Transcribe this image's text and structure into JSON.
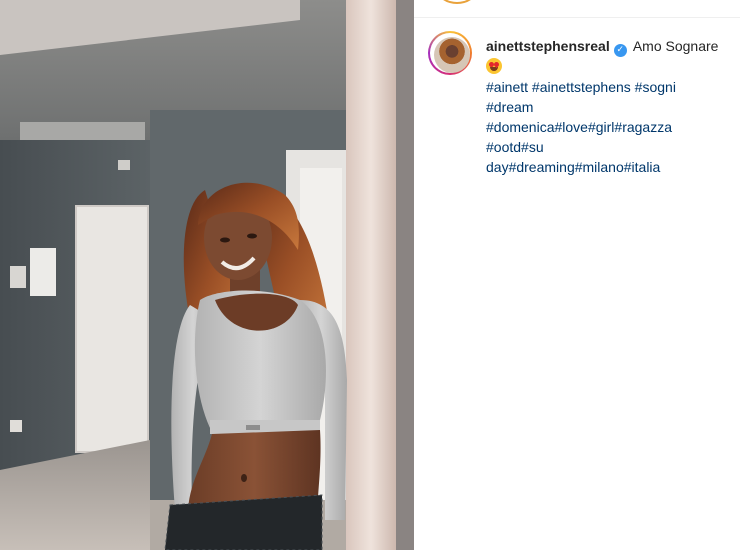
{
  "post": {
    "username": "ainettstephensreal",
    "verified_icon": "verified-badge-icon",
    "caption": "Amo Sognare",
    "emoji_icon": "heart-eyes-emoji-icon",
    "hashtag_lines": [
      "#ainett #ainettstephens #sogni",
      "#dream",
      "#domenica#love#girl#ragazza",
      "#ootd#su",
      "day#dreaming#milano#italia"
    ]
  },
  "colors": {
    "username": "#262626",
    "hashtag": "#00376b",
    "verified": "#3897f0",
    "story_ring": [
      "#f9c33a",
      "#d62e74",
      "#a52fbf"
    ]
  }
}
